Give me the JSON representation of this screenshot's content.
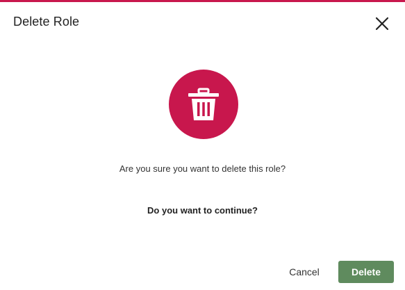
{
  "dialog": {
    "title": "Delete Role",
    "close_icon": "close-icon",
    "main_icon": "trash-icon",
    "message": "Are you sure you want to delete this role?",
    "question": "Do you want to continue?",
    "cancel_label": "Cancel",
    "delete_label": "Delete"
  },
  "colors": {
    "accent": "#c8174d",
    "delete_button": "#5f8b5e",
    "text": "#222222"
  }
}
